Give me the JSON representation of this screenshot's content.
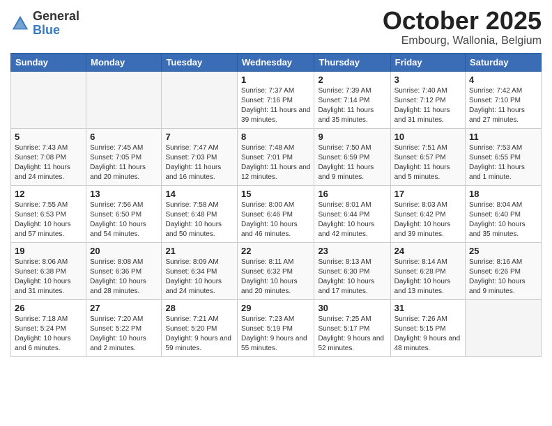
{
  "logo": {
    "general": "General",
    "blue": "Blue"
  },
  "title": "October 2025",
  "subtitle": "Embourg, Wallonia, Belgium",
  "weekdays": [
    "Sunday",
    "Monday",
    "Tuesday",
    "Wednesday",
    "Thursday",
    "Friday",
    "Saturday"
  ],
  "weeks": [
    [
      {
        "day": "",
        "info": ""
      },
      {
        "day": "",
        "info": ""
      },
      {
        "day": "",
        "info": ""
      },
      {
        "day": "1",
        "info": "Sunrise: 7:37 AM\nSunset: 7:16 PM\nDaylight: 11 hours\nand 39 minutes."
      },
      {
        "day": "2",
        "info": "Sunrise: 7:39 AM\nSunset: 7:14 PM\nDaylight: 11 hours\nand 35 minutes."
      },
      {
        "day": "3",
        "info": "Sunrise: 7:40 AM\nSunset: 7:12 PM\nDaylight: 11 hours\nand 31 minutes."
      },
      {
        "day": "4",
        "info": "Sunrise: 7:42 AM\nSunset: 7:10 PM\nDaylight: 11 hours\nand 27 minutes."
      }
    ],
    [
      {
        "day": "5",
        "info": "Sunrise: 7:43 AM\nSunset: 7:08 PM\nDaylight: 11 hours\nand 24 minutes."
      },
      {
        "day": "6",
        "info": "Sunrise: 7:45 AM\nSunset: 7:05 PM\nDaylight: 11 hours\nand 20 minutes."
      },
      {
        "day": "7",
        "info": "Sunrise: 7:47 AM\nSunset: 7:03 PM\nDaylight: 11 hours\nand 16 minutes."
      },
      {
        "day": "8",
        "info": "Sunrise: 7:48 AM\nSunset: 7:01 PM\nDaylight: 11 hours\nand 12 minutes."
      },
      {
        "day": "9",
        "info": "Sunrise: 7:50 AM\nSunset: 6:59 PM\nDaylight: 11 hours\nand 9 minutes."
      },
      {
        "day": "10",
        "info": "Sunrise: 7:51 AM\nSunset: 6:57 PM\nDaylight: 11 hours\nand 5 minutes."
      },
      {
        "day": "11",
        "info": "Sunrise: 7:53 AM\nSunset: 6:55 PM\nDaylight: 11 hours\nand 1 minute."
      }
    ],
    [
      {
        "day": "12",
        "info": "Sunrise: 7:55 AM\nSunset: 6:53 PM\nDaylight: 10 hours\nand 57 minutes."
      },
      {
        "day": "13",
        "info": "Sunrise: 7:56 AM\nSunset: 6:50 PM\nDaylight: 10 hours\nand 54 minutes."
      },
      {
        "day": "14",
        "info": "Sunrise: 7:58 AM\nSunset: 6:48 PM\nDaylight: 10 hours\nand 50 minutes."
      },
      {
        "day": "15",
        "info": "Sunrise: 8:00 AM\nSunset: 6:46 PM\nDaylight: 10 hours\nand 46 minutes."
      },
      {
        "day": "16",
        "info": "Sunrise: 8:01 AM\nSunset: 6:44 PM\nDaylight: 10 hours\nand 42 minutes."
      },
      {
        "day": "17",
        "info": "Sunrise: 8:03 AM\nSunset: 6:42 PM\nDaylight: 10 hours\nand 39 minutes."
      },
      {
        "day": "18",
        "info": "Sunrise: 8:04 AM\nSunset: 6:40 PM\nDaylight: 10 hours\nand 35 minutes."
      }
    ],
    [
      {
        "day": "19",
        "info": "Sunrise: 8:06 AM\nSunset: 6:38 PM\nDaylight: 10 hours\nand 31 minutes."
      },
      {
        "day": "20",
        "info": "Sunrise: 8:08 AM\nSunset: 6:36 PM\nDaylight: 10 hours\nand 28 minutes."
      },
      {
        "day": "21",
        "info": "Sunrise: 8:09 AM\nSunset: 6:34 PM\nDaylight: 10 hours\nand 24 minutes."
      },
      {
        "day": "22",
        "info": "Sunrise: 8:11 AM\nSunset: 6:32 PM\nDaylight: 10 hours\nand 20 minutes."
      },
      {
        "day": "23",
        "info": "Sunrise: 8:13 AM\nSunset: 6:30 PM\nDaylight: 10 hours\nand 17 minutes."
      },
      {
        "day": "24",
        "info": "Sunrise: 8:14 AM\nSunset: 6:28 PM\nDaylight: 10 hours\nand 13 minutes."
      },
      {
        "day": "25",
        "info": "Sunrise: 8:16 AM\nSunset: 6:26 PM\nDaylight: 10 hours\nand 9 minutes."
      }
    ],
    [
      {
        "day": "26",
        "info": "Sunrise: 7:18 AM\nSunset: 5:24 PM\nDaylight: 10 hours\nand 6 minutes."
      },
      {
        "day": "27",
        "info": "Sunrise: 7:20 AM\nSunset: 5:22 PM\nDaylight: 10 hours\nand 2 minutes."
      },
      {
        "day": "28",
        "info": "Sunrise: 7:21 AM\nSunset: 5:20 PM\nDaylight: 9 hours\nand 59 minutes."
      },
      {
        "day": "29",
        "info": "Sunrise: 7:23 AM\nSunset: 5:19 PM\nDaylight: 9 hours\nand 55 minutes."
      },
      {
        "day": "30",
        "info": "Sunrise: 7:25 AM\nSunset: 5:17 PM\nDaylight: 9 hours\nand 52 minutes."
      },
      {
        "day": "31",
        "info": "Sunrise: 7:26 AM\nSunset: 5:15 PM\nDaylight: 9 hours\nand 48 minutes."
      },
      {
        "day": "",
        "info": ""
      }
    ]
  ]
}
